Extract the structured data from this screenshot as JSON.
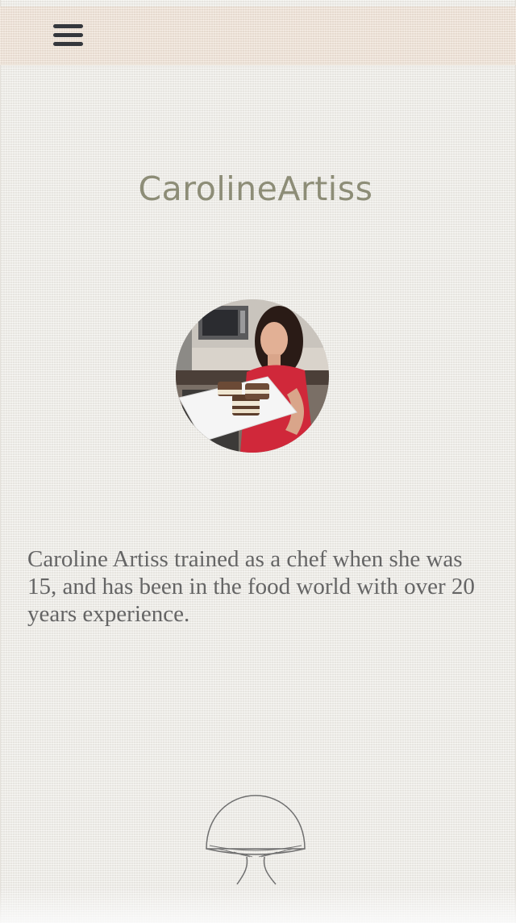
{
  "header": {
    "menu_icon": "hamburger-menu-icon"
  },
  "main": {
    "title": "CarolineArtiss",
    "bio": "Caroline Artiss trained as a chef when she was 15, and has been in the food world with over 20 years experience."
  },
  "footer": {
    "logo_icon": "mushroom-icon"
  },
  "colors": {
    "header_bg": "#f2e6da",
    "title": "#8d8d77",
    "body_text": "#656565",
    "menu_icon": "#34373d"
  }
}
